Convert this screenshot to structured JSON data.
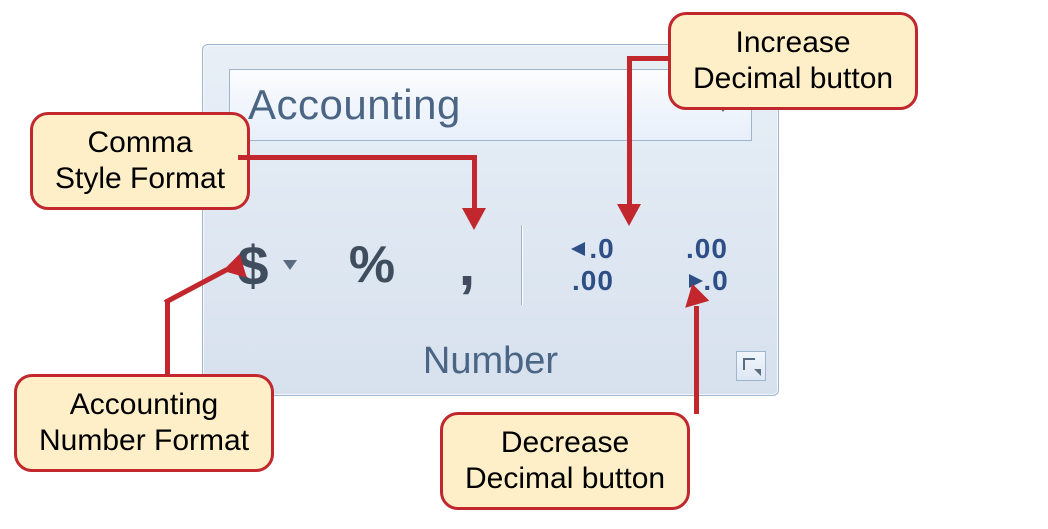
{
  "ribbon": {
    "group_label": "Number",
    "format_selected": "Accounting",
    "buttons": {
      "accounting_glyph": "$",
      "percent_glyph": "%",
      "comma_glyph": ",",
      "increase_decimal_top": ".0",
      "increase_decimal_bottom": ".00",
      "decrease_decimal_top": ".00",
      "decrease_decimal_bottom": ".0"
    }
  },
  "callouts": {
    "increase_decimal": "Increase\nDecimal button",
    "comma_style": "Comma\nStyle Format",
    "accounting_number": "Accounting\nNumber Format",
    "decrease_decimal": "Decrease\nDecimal button"
  }
}
